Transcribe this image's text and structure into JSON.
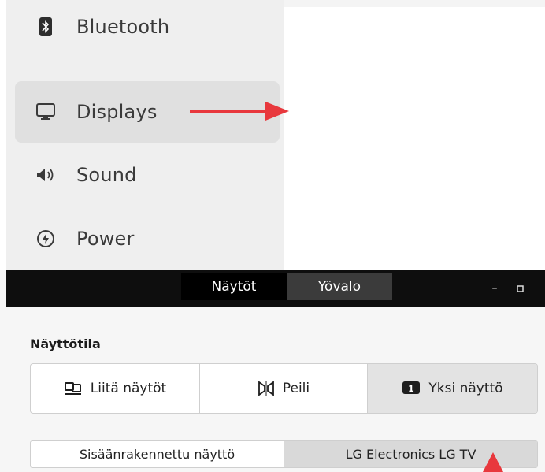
{
  "sidebar": {
    "items": [
      {
        "label": "Bluetooth",
        "icon": "bluetooth-icon",
        "active": false
      },
      {
        "label": "Displays",
        "icon": "monitor-icon",
        "active": true
      },
      {
        "label": "Sound",
        "icon": "speaker-icon",
        "active": false
      },
      {
        "label": "Power",
        "icon": "power-icon",
        "active": false
      }
    ]
  },
  "displays_window": {
    "tabs": [
      "Näytöt",
      "Yövalo"
    ],
    "active_tab": "Näytöt",
    "section_label": "Näyttötila",
    "modes": [
      {
        "label": "Liitä näytöt",
        "icon": "join-displays-icon"
      },
      {
        "label": "Peili",
        "icon": "mirror-icon"
      },
      {
        "label": "Yksi näyttö",
        "icon": "single-display-icon",
        "selected": true,
        "badge": "1"
      }
    ],
    "displays": [
      {
        "label": "Sisäänrakennettu näyttö",
        "selected": false
      },
      {
        "label": "LG Electronics LG TV",
        "selected": true
      }
    ]
  },
  "colors": {
    "annotation_arrow": "#e8383d",
    "titlebar": "#0e0e0e",
    "sidebar_bg": "#efefef",
    "selected_bg": "#e0e0e0"
  }
}
